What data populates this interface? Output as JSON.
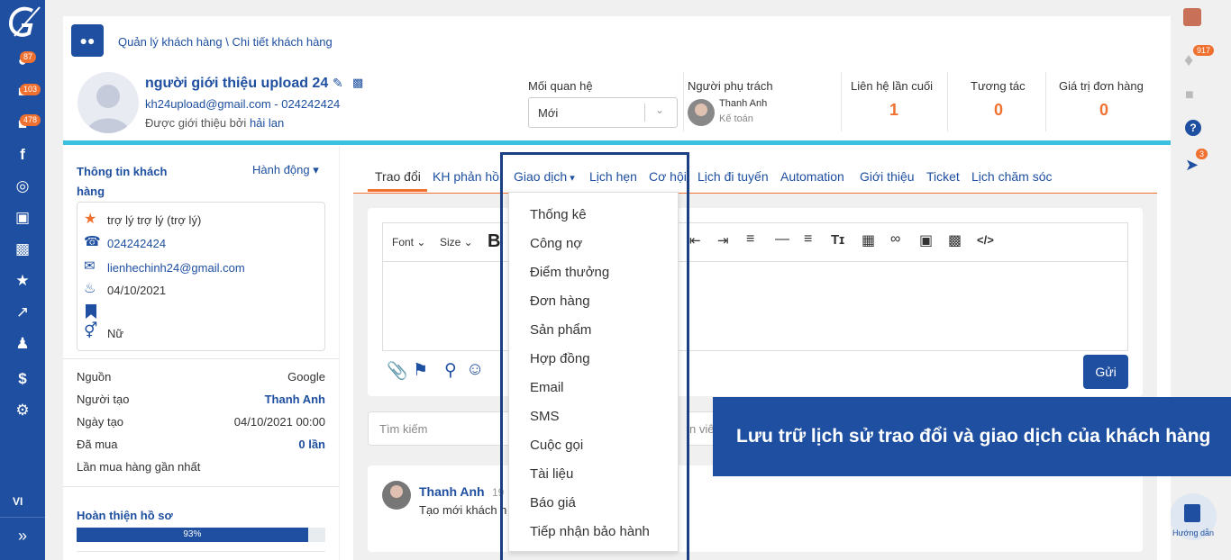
{
  "sidebar": {
    "badges": [
      "87",
      "103",
      "478"
    ],
    "lang": "VI"
  },
  "breadcrumb": "Quản lý khách hàng \\ Chi tiết khách hàng",
  "customer": {
    "name": "người giới thiệu upload 24",
    "contact": "kh24upload@gmail.com - 024242424",
    "referred_prefix": "Được giới thiệu bởi ",
    "referred_by": "hải lan"
  },
  "relation": {
    "label": "Mối quan hệ",
    "value": "Mới"
  },
  "owner": {
    "label": "Người phụ trách",
    "name": "Thanh Anh",
    "role": "Kế toán"
  },
  "stats": [
    {
      "label": "Liên hệ lần cuối",
      "value": "1"
    },
    {
      "label": "Tương tác",
      "value": "0"
    },
    {
      "label": "Giá trị đơn hàng",
      "value": "0"
    }
  ],
  "info": {
    "title": "Thông tin khách hàng",
    "action": "Hành động",
    "role": "trợ lý trợ lý (trợ lý)",
    "phone": "024242424",
    "email": "lienhechinh24@gmail.com",
    "birthday": "04/10/2021",
    "gender": "Nữ"
  },
  "details": [
    {
      "label": "Nguồn",
      "value": "Google"
    },
    {
      "label": "Người tạo",
      "value": "Thanh Anh"
    },
    {
      "label": "Ngày tạo",
      "value": "04/10/2021 00:00"
    },
    {
      "label": "Đã mua",
      "value": "0 lần"
    },
    {
      "label": "Lần mua hàng gần nhất",
      "value": ""
    }
  ],
  "profile": {
    "title": "Hoàn thiện hồ sơ",
    "percent_label": "93%",
    "percent": 93
  },
  "tabs": [
    "Trao đổi",
    "KH phản hồi",
    "Giao dịch",
    "Lịch hẹn",
    "Cơ hội",
    "Lịch đi tuyến",
    "Automation",
    "Giới thiệu",
    "Ticket",
    "Lịch chăm sóc"
  ],
  "editor": {
    "font": "Font",
    "size": "Size",
    "bold": "B",
    "send": "Gửi"
  },
  "search": {
    "placeholder": "Tìm kiếm",
    "filter_partial": "n viên"
  },
  "activity": {
    "user": "Thanh Anh",
    "time_partial": "19",
    "text": "Tạo mới khách h"
  },
  "dropdown": [
    "Thống kê",
    "Công nợ",
    "Điểm thưởng",
    "Đơn hàng",
    "Sản phẩm",
    "Hợp đồng",
    "Email",
    "SMS",
    "Cuộc gọi",
    "Tài liệu",
    "Báo giá",
    "Tiếp nhận bảo hành"
  ],
  "banner": "Lưu trữ lịch sử trao đổi và giao dịch của khách hàng",
  "right": {
    "notif_badge": "917",
    "rocket_badge": "3",
    "guide": "Hướng dẫn"
  },
  "colors": {
    "brand": "#1e4fa0",
    "accent": "#f07030",
    "cyan": "#3bc1dd"
  }
}
